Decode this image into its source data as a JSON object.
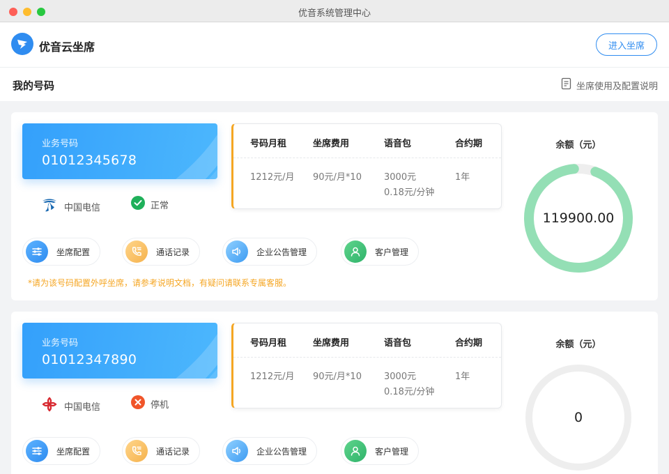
{
  "window": {
    "title": "优音系统管理中心"
  },
  "app": {
    "name": "优音云坐席",
    "enter_button": "进入坐席"
  },
  "section": {
    "title": "我的号码",
    "help_link": "坐席使用及配置说明"
  },
  "package_headers": [
    "号码月租",
    "坐席费用",
    "语音包",
    "合约期"
  ],
  "actions": [
    "坐席配置",
    "通话记录",
    "企业公告管理",
    "客户管理"
  ],
  "numbers": [
    {
      "business_label": "业务号码",
      "number": "01012345678",
      "carrier": "中国电信",
      "carrier_icon": "china-telecom-icon",
      "status": "正常",
      "status_icon": "check-circle-icon",
      "status_color": "#1fb05a",
      "package": {
        "rent": "1212元/月",
        "seat_fee": "90元/月*10",
        "voice_line1": "3000元",
        "voice_line2": "0.18元/分钟",
        "term": "1年"
      },
      "note": "*请为该号码配置外呼坐席，请参考说明文档，有疑问请联系专属客服。",
      "balance_label": "余额（元）",
      "balance": "119900.00",
      "ring_fraction": 0.93,
      "ring_color": "#94dfb5"
    },
    {
      "business_label": "业务号码",
      "number": "01012347890",
      "carrier": "中国电信",
      "carrier_icon": "china-unicom-icon",
      "status": "停机",
      "status_icon": "x-circle-icon",
      "status_color": "#f0552a",
      "package": {
        "rent": "1212元/月",
        "seat_fee": "90元/月*10",
        "voice_line1": "3000元",
        "voice_line2": "0.18元/分钟",
        "term": "1年"
      },
      "balance_label": "余额（元）",
      "balance": "0",
      "ring_fraction": 0,
      "ring_color": "#eeeeee"
    }
  ]
}
